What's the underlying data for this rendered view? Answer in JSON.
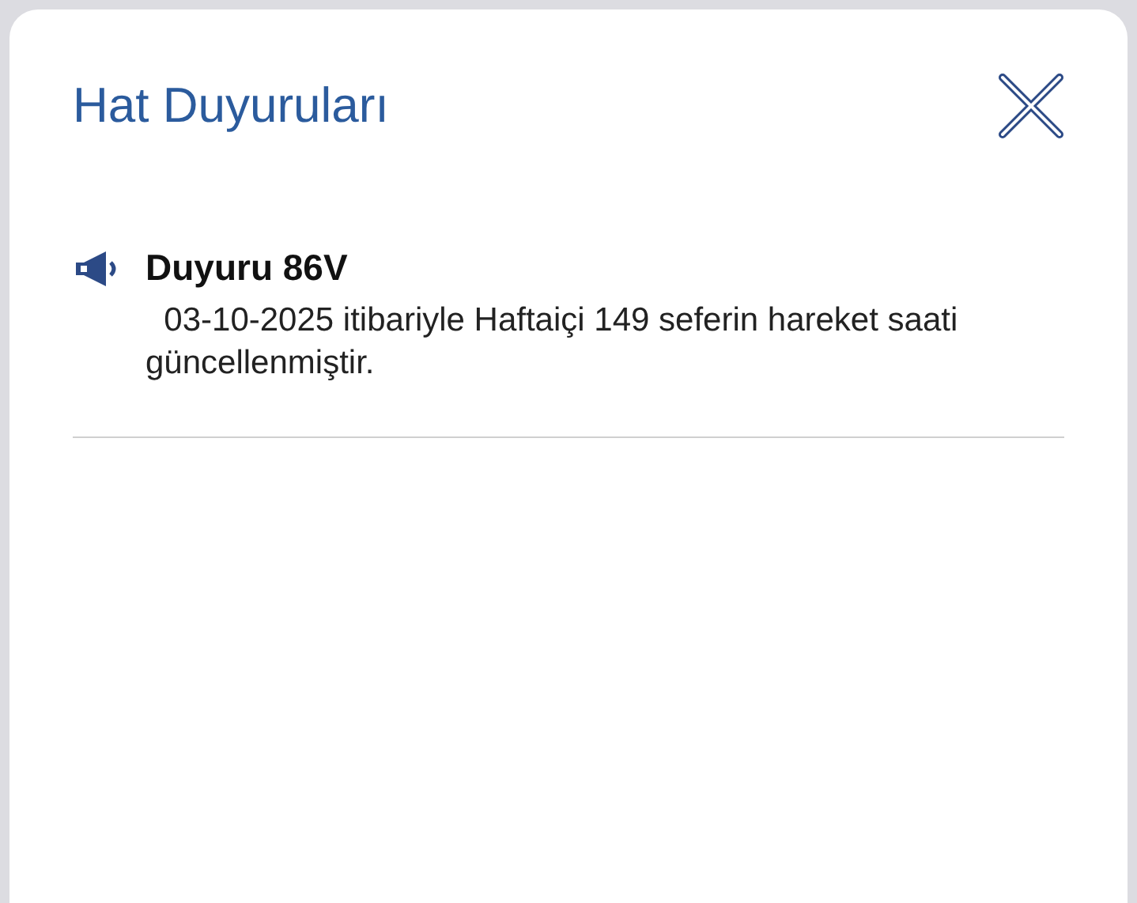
{
  "title": "Hat Duyuruları",
  "announcements": [
    {
      "title": "Duyuru 86V",
      "body": "  03-10-2025 itibariyle Haftaiçi 149 seferin hareket saati güncellenmiştir."
    }
  ]
}
